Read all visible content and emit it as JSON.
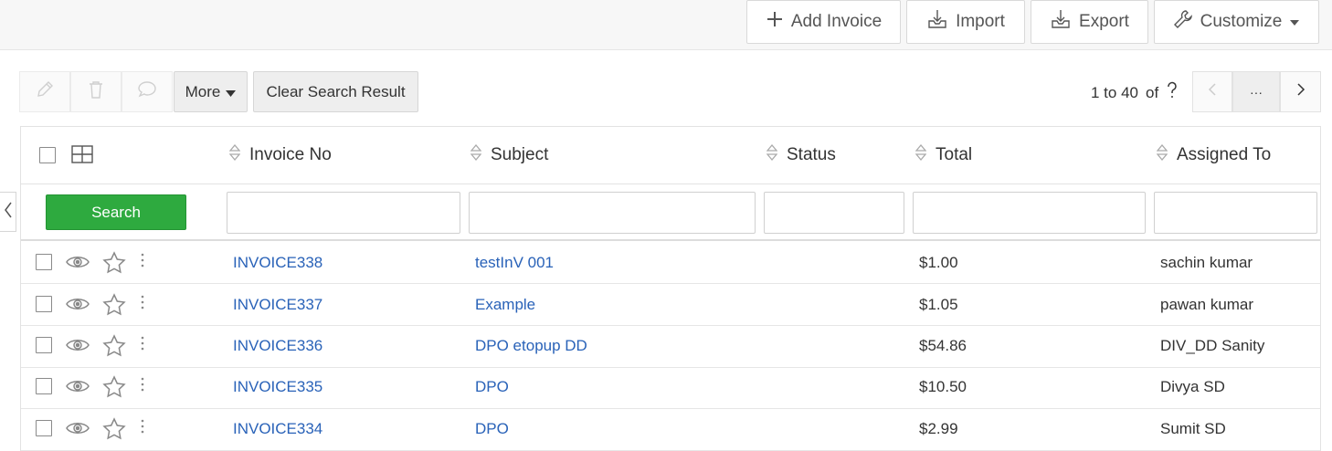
{
  "header_actions": {
    "add_invoice": "Add Invoice",
    "import": "Import",
    "export": "Export",
    "customize": "Customize"
  },
  "toolbar": {
    "more": "More",
    "clear_search": "Clear Search Result"
  },
  "pagination": {
    "range": "1 to 40",
    "of": "of",
    "more": "···"
  },
  "table": {
    "columns": [
      "Invoice No",
      "Subject",
      "Status",
      "Total",
      "Assigned To"
    ],
    "search_button": "Search",
    "rows": [
      {
        "invoice_no": "INVOICE338",
        "subject": "testInV 001",
        "status": "",
        "total": "$1.00",
        "assigned_to": "sachin kumar"
      },
      {
        "invoice_no": "INVOICE337",
        "subject": "Example",
        "status": "",
        "total": "$1.05",
        "assigned_to": "pawan kumar"
      },
      {
        "invoice_no": "INVOICE336",
        "subject": "DPO etopup DD",
        "status": "",
        "total": "$54.86",
        "assigned_to": "DIV_DD Sanity"
      },
      {
        "invoice_no": "INVOICE335",
        "subject": "DPO",
        "status": "",
        "total": "$10.50",
        "assigned_to": "Divya SD"
      },
      {
        "invoice_no": "INVOICE334",
        "subject": "DPO",
        "status": "",
        "total": "$2.99",
        "assigned_to": "Sumit SD"
      }
    ]
  },
  "colors": {
    "link": "#2962b8",
    "search_button": "#2eaa3f"
  }
}
